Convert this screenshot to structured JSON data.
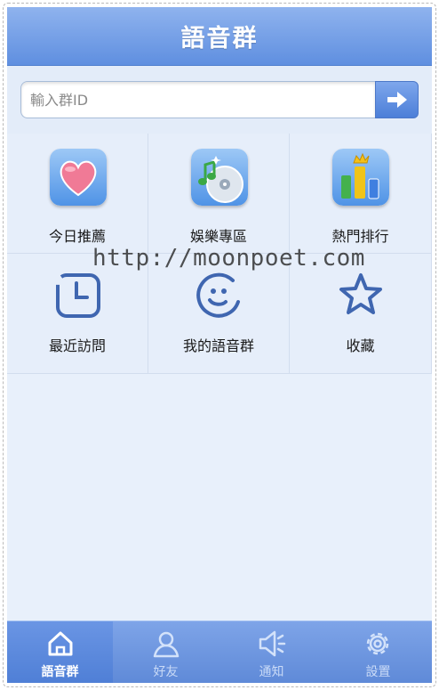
{
  "header": {
    "title": "語音群"
  },
  "search": {
    "placeholder": "輸入群ID",
    "value": "",
    "submit_icon": "arrow-right-icon"
  },
  "grid": [
    {
      "label": "今日推薦",
      "icon": "heart-icon"
    },
    {
      "label": "娛樂專區",
      "icon": "music-disc-icon"
    },
    {
      "label": "熱門排行",
      "icon": "ranking-chart-icon"
    },
    {
      "label": "最近訪問",
      "icon": "clock-icon"
    },
    {
      "label": "我的語音群",
      "icon": "face-icon"
    },
    {
      "label": "收藏",
      "icon": "star-icon"
    }
  ],
  "watermark": "http://moonpoet.com",
  "tabs": [
    {
      "label": "語音群",
      "icon": "home-icon",
      "active": true
    },
    {
      "label": "好友",
      "icon": "person-icon",
      "active": false
    },
    {
      "label": "通知",
      "icon": "speaker-icon",
      "active": false
    },
    {
      "label": "設置",
      "icon": "gear-icon",
      "active": false
    }
  ],
  "colors": {
    "accent": "#5f8fe0",
    "background": "#e8f0fb",
    "icon_blue": "#3f66b0"
  }
}
